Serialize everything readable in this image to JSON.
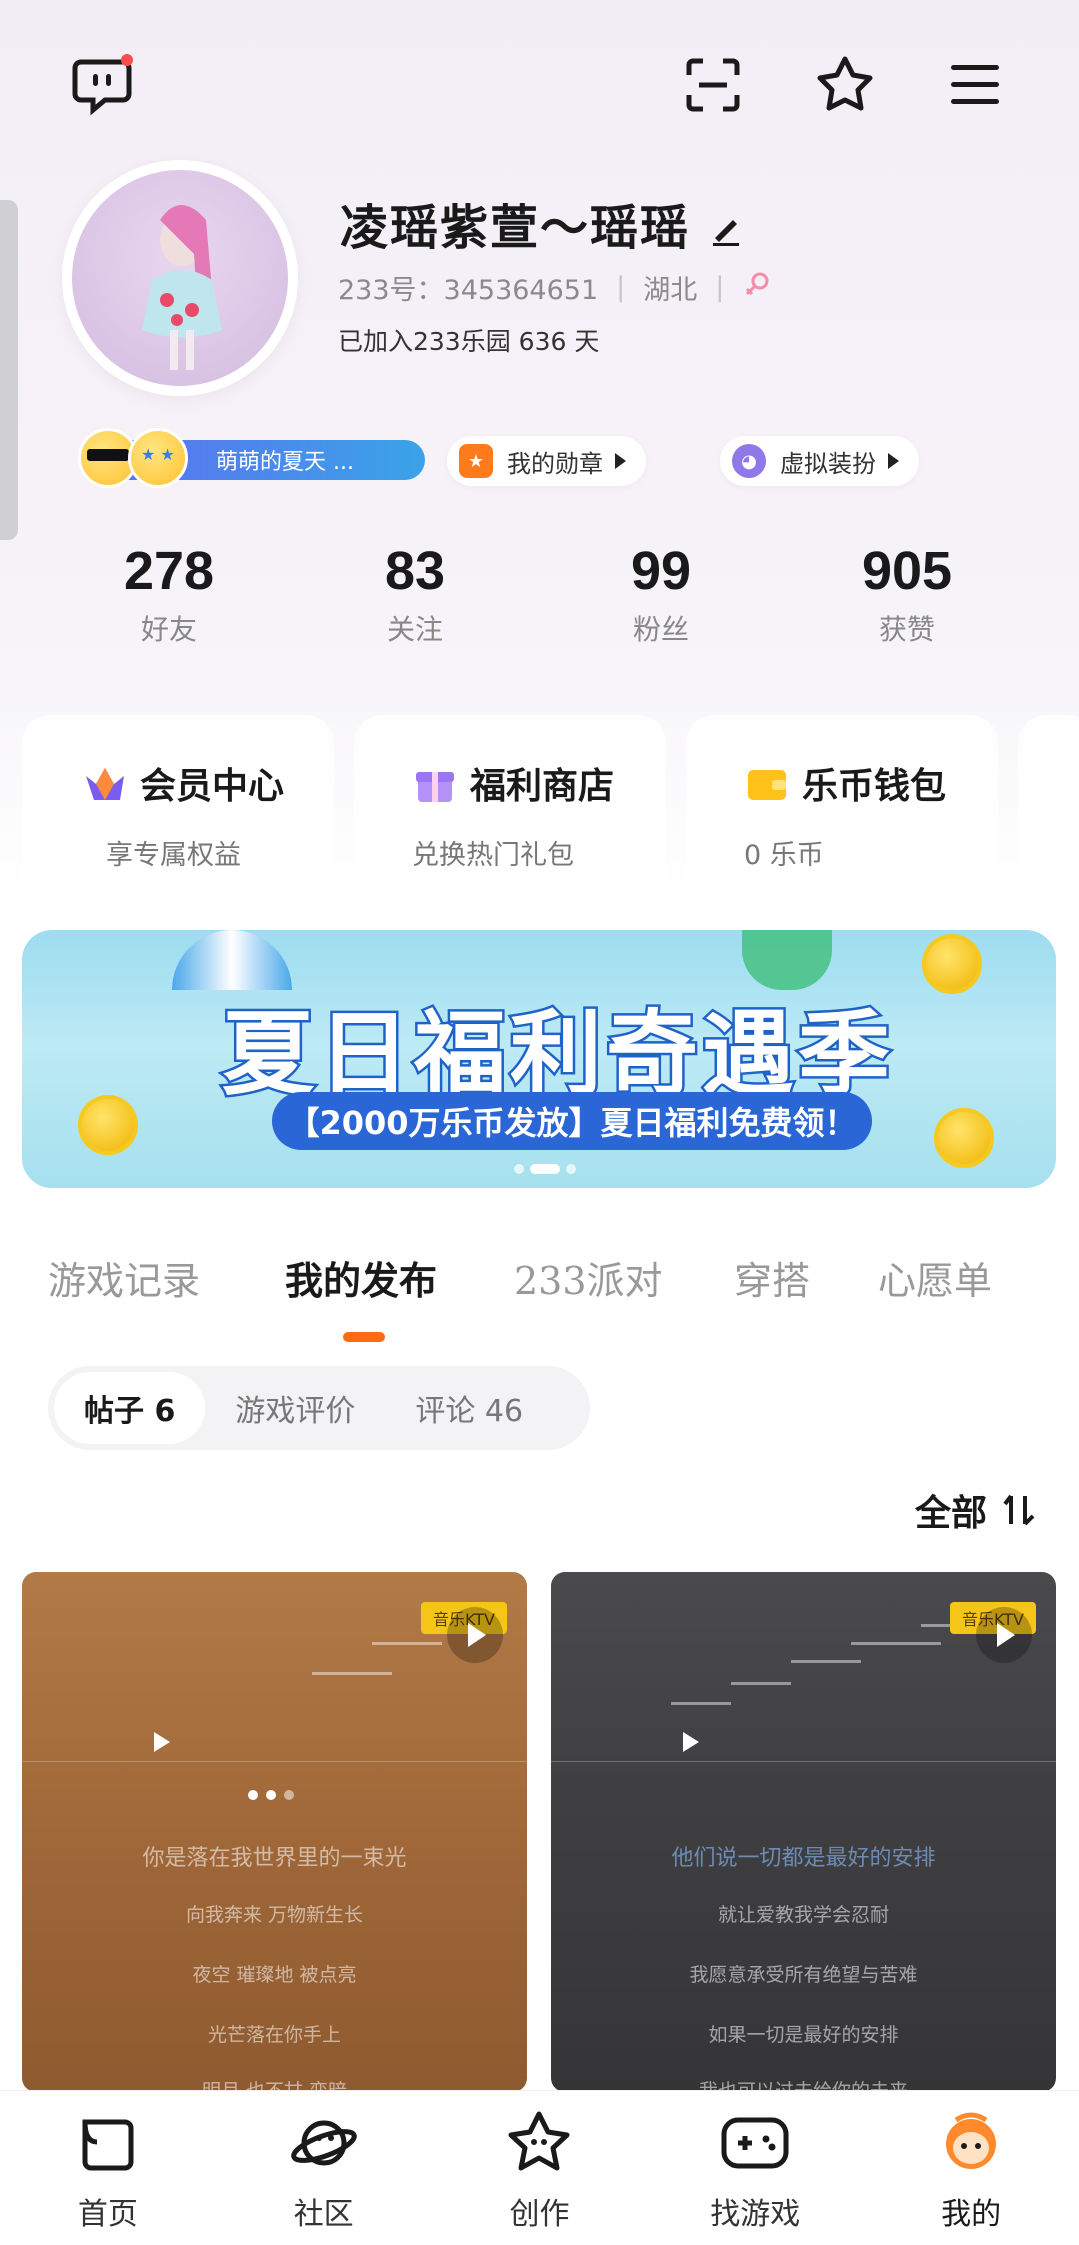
{
  "profile": {
    "username": "凌瑶紫萱～瑶瑶",
    "id_line": "233号：345364651",
    "location": "湖北",
    "joined": "已加入233乐园 636 天"
  },
  "badges": {
    "title_badge": "萌萌的夏天 ...",
    "medal_label": "我的勋章",
    "dress_label": "虚拟装扮"
  },
  "stats": [
    {
      "num": "278",
      "label": "好友"
    },
    {
      "num": "83",
      "label": "关注"
    },
    {
      "num": "99",
      "label": "粉丝"
    },
    {
      "num": "905",
      "label": "获赞"
    }
  ],
  "cards": [
    {
      "title": "会员中心",
      "sub": "享专属权益"
    },
    {
      "title": "福利商店",
      "sub": "兑换热门礼包"
    },
    {
      "title": "乐币钱包",
      "sub": "0 乐币"
    }
  ],
  "banner": {
    "title": "夏日福利奇遇季",
    "subtitle": "【2000万乐币发放】夏日福利免费领！"
  },
  "tabs": [
    "游戏记录",
    "我的发布",
    "233派对",
    "穿搭",
    "心愿单"
  ],
  "subtabs": [
    "帖子 6",
    "游戏评价",
    "评论 46"
  ],
  "sort_label": "全部",
  "posts": [
    {
      "ktv": "音乐KTV",
      "lyrics": [
        "你是落在我世界里的一束光",
        "向我奔来 万物新生长",
        "夜空 璀璨地 被点亮",
        "光芒落在你手上",
        "明月 也不甘 变暗"
      ]
    },
    {
      "ktv": "音乐KTV",
      "lyrics": [
        "他们说一切都是最好的安排",
        "就让爱教我学会忍耐",
        "我愿意承受所有绝望与苦难",
        "如果一切是最好的安排",
        "我也可以过去给你的未来"
      ]
    }
  ],
  "nav": [
    "首页",
    "社区",
    "创作",
    "找游戏",
    "我的"
  ],
  "colors": {
    "accent": "#ff6a13",
    "banner_blue": "#2b66d6"
  }
}
